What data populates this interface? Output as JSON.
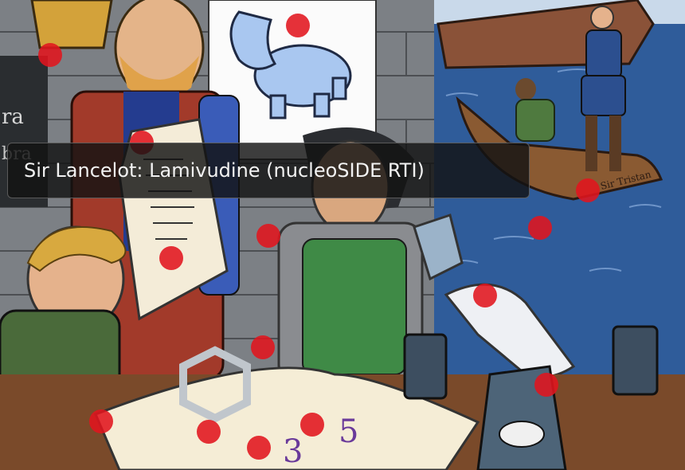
{
  "tooltip": {
    "text": "Sir Lancelot: Lamivudine (nucleoSIDE RTI)"
  },
  "scene": {
    "boat_label": "Sir Tristan",
    "book_numbers": [
      "3",
      "5"
    ],
    "chalkboard_letters": [
      "ra",
      "bra"
    ]
  },
  "hotspots": [
    {
      "name": "hotspot-crown-king"
    },
    {
      "name": "hotspot-hippo-poster"
    },
    {
      "name": "hotspot-scroll-top"
    },
    {
      "name": "hotspot-boat-tristan"
    },
    {
      "name": "hotspot-lancelot-chest"
    },
    {
      "name": "hotspot-water"
    },
    {
      "name": "hotspot-scroll-letter"
    },
    {
      "name": "hotspot-bandaged-feet"
    },
    {
      "name": "hotspot-gauntlet"
    },
    {
      "name": "hotspot-pitcher"
    },
    {
      "name": "hotspot-book-left"
    },
    {
      "name": "hotspot-amulet"
    },
    {
      "name": "hotspot-book-numbers"
    },
    {
      "name": "hotspot-book-bottom"
    }
  ]
}
